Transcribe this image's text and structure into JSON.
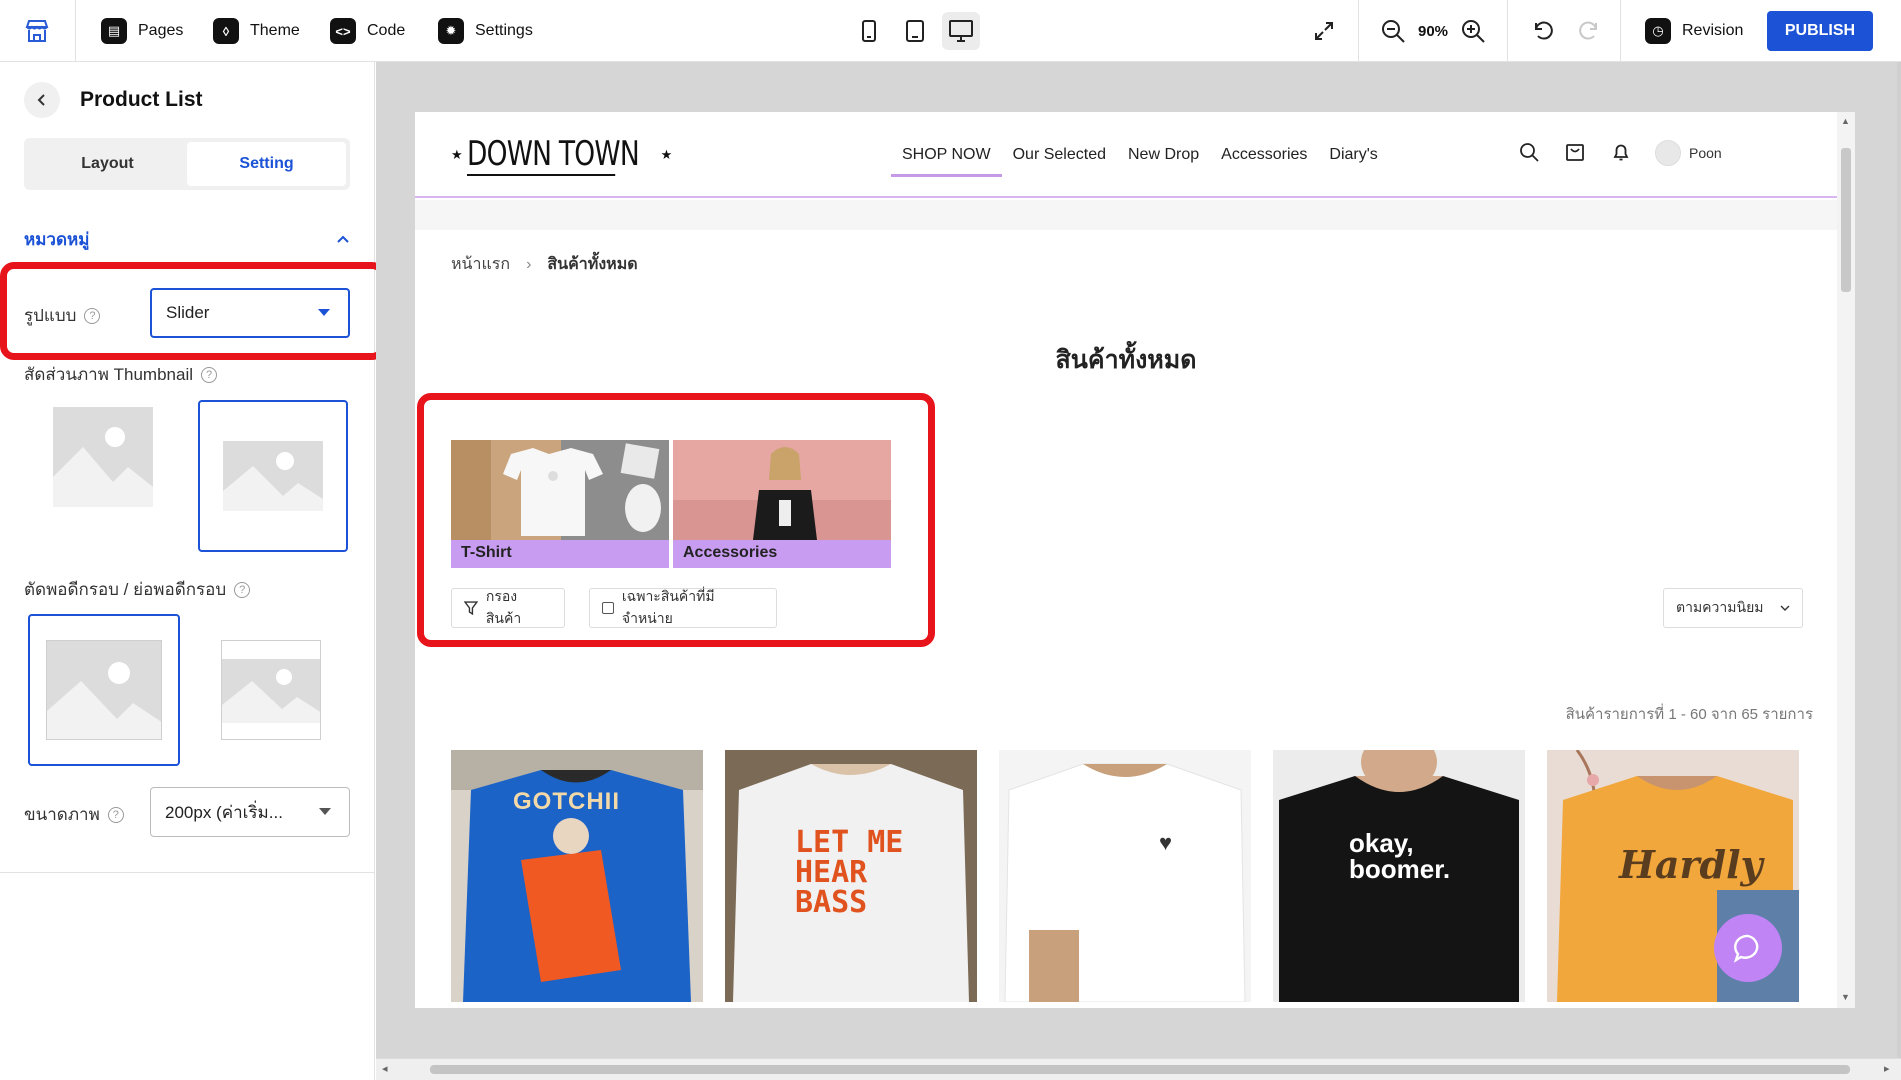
{
  "toolbar": {
    "pages_label": "Pages",
    "theme_label": "Theme",
    "code_label": "Code",
    "settings_label": "Settings",
    "zoom": "90%",
    "revision_label": "Revision",
    "publish_label": "PUBLISH"
  },
  "panel": {
    "title": "Product List",
    "tabs": [
      "Layout",
      "Setting"
    ],
    "active_tab": "Setting",
    "section_title": "หมวดหมู่",
    "style_label": "รูปแบบ",
    "style_value": "Slider",
    "thumbnail_ratio_label": "สัดส่วนภาพ Thumbnail",
    "crop_label": "ตัดพอดีกรอบ / ย่อพอดีกรอบ",
    "image_size_label": "ขนาดภาพ",
    "image_size_value": "200px (ค่าเริ่ม..."
  },
  "store": {
    "logo_text": "DOWN TOWN",
    "nav": [
      "SHOP NOW",
      "Our Selected",
      "New Drop",
      "Accessories",
      "Diary's"
    ],
    "active_nav": "SHOP NOW",
    "user_name": "Poon",
    "breadcrumb": [
      "หน้าแรก",
      "สินค้าทั้งหมด"
    ],
    "page_title": "สินค้าทั้งหมด",
    "categories": [
      {
        "name": "T-Shirt"
      },
      {
        "name": "Accessories"
      }
    ],
    "filter_label": "กรองสินค้า",
    "instock_label": "เฉพาะสินค้าที่มีจำหน่าย",
    "sort_label": "ตามความนิยม",
    "result_count": "สินค้ารายการที่ 1 - 60 จาก 65 รายการ",
    "products": [
      {
        "print": "GOTCHII"
      },
      {
        "print": "LET ME HEAR BASS"
      },
      {
        "print": "♥"
      },
      {
        "print": "okay, boomer."
      },
      {
        "print": "Hardly"
      }
    ]
  },
  "colors": {
    "accent": "#1b52d6",
    "highlight": "#e8141b",
    "category_bar": "#c89cf0",
    "chat_bubble": "#c084f5"
  }
}
